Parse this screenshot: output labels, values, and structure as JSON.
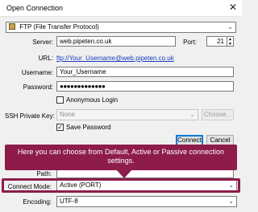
{
  "window": {
    "title": "Open Connection"
  },
  "protocol": {
    "selected": "FTP (File Transfer Protocol)"
  },
  "server": {
    "label": "Server:",
    "value": "web.pipeten.co.uk"
  },
  "port": {
    "label": "Port:",
    "value": "21"
  },
  "url": {
    "label": "URL:",
    "value": "ftp://Your_Username@web.pipeten.co.uk"
  },
  "username": {
    "label": "Username:",
    "value": "Your_Username"
  },
  "password": {
    "label": "Password:",
    "value": "●●●●●●●●●●●●●"
  },
  "anonymous": {
    "label": "Anonymous Login",
    "checked": false
  },
  "ssh_key": {
    "label": "SSH Private Key:",
    "value": "None",
    "choose_label": "Choose..."
  },
  "save_password": {
    "label": "Save Password",
    "checked": true
  },
  "actions": {
    "connect_label": "Connect",
    "cancel_label": "Cancel"
  },
  "callout": {
    "text": "Here you can choose from Default, Active or Passive connection settings."
  },
  "path": {
    "label": "Path:",
    "value": ""
  },
  "connect_mode": {
    "label": "Connect Mode:",
    "selected": "Active (PORT)"
  },
  "encoding": {
    "label": "Encoding:",
    "selected": "UTF-8"
  },
  "colors": {
    "accent": "#8e1c4a",
    "link": "#1a3dbd",
    "default_button_border": "#0078d7"
  }
}
